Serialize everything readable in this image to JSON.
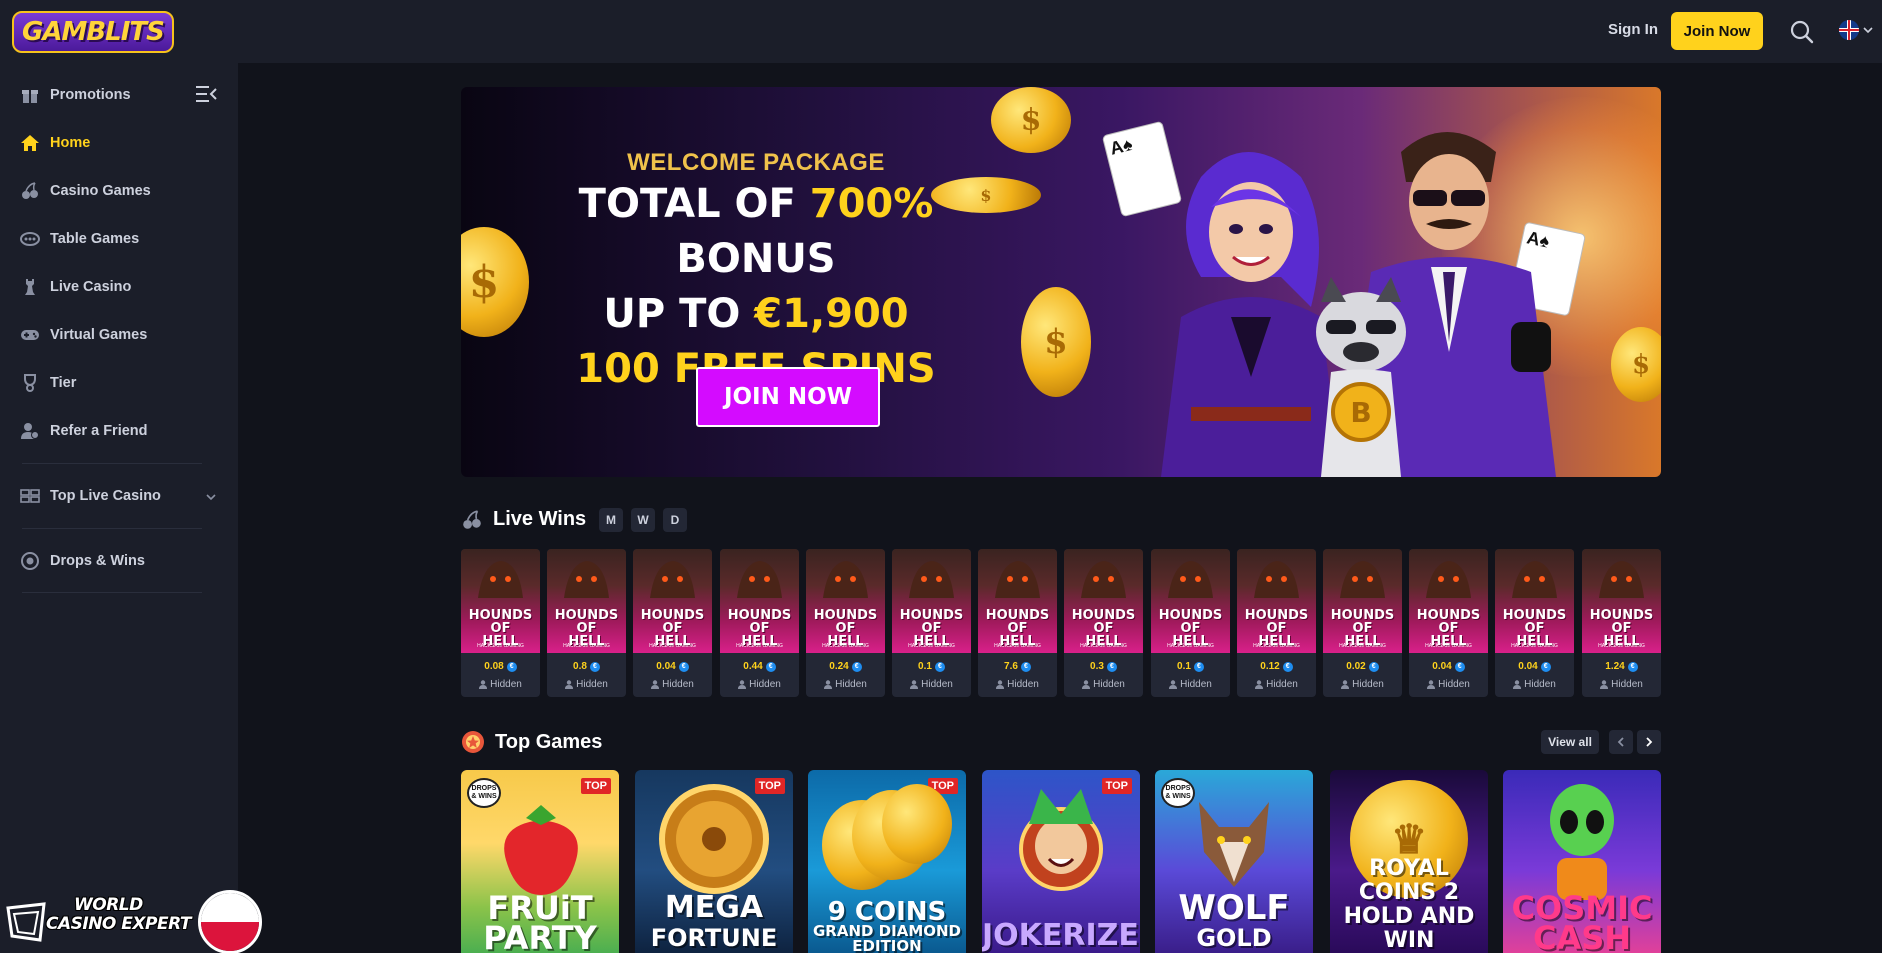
{
  "header": {
    "logo_text": "GAMBLITS",
    "signin_label": "Sign In",
    "join_label": "Join Now",
    "search_icon": "search-icon",
    "language_flag": "uk-flag-icon"
  },
  "sidebar": {
    "items": [
      {
        "label": "Promotions",
        "icon": "gift-icon"
      },
      {
        "label": "Home",
        "icon": "home-icon",
        "active": true
      },
      {
        "label": "Casino Games",
        "icon": "cherries-icon"
      },
      {
        "label": "Table Games",
        "icon": "table-icon"
      },
      {
        "label": "Live Casino",
        "icon": "chess-icon"
      },
      {
        "label": "Virtual Games",
        "icon": "gamepad-icon"
      },
      {
        "label": "Tier",
        "icon": "trophy-icon"
      },
      {
        "label": "Refer a Friend",
        "icon": "users-icon"
      },
      {
        "label": "Top Live Casino",
        "icon": "grid-icon"
      },
      {
        "label": "Drops & Wins",
        "icon": "drops-wins-icon"
      }
    ],
    "accent_color": "#ffd21c"
  },
  "banner": {
    "subtitle": "WELCOME PACKAGE",
    "line1_a": "TOTAL OF ",
    "line1_b": "700%",
    "line1_c": " BONUS",
    "line2_a": "UP TO ",
    "line2_b": "€1,900",
    "line3": "100 FREE SPINS",
    "cta": "JOIN NOW"
  },
  "live_wins": {
    "title": "Live Wins",
    "filters": [
      "M",
      "W",
      "D"
    ],
    "game_title_1": "HOUNDS OF",
    "game_title_2": "HELL",
    "game_studio": "HACKSAW GAMING",
    "items": [
      {
        "amount": "0.08",
        "user": "Hidden"
      },
      {
        "amount": "0.8",
        "user": "Hidden"
      },
      {
        "amount": "0.04",
        "user": "Hidden"
      },
      {
        "amount": "0.44",
        "user": "Hidden"
      },
      {
        "amount": "0.24",
        "user": "Hidden"
      },
      {
        "amount": "0.1",
        "user": "Hidden"
      },
      {
        "amount": "7.6",
        "user": "Hidden"
      },
      {
        "amount": "0.3",
        "user": "Hidden"
      },
      {
        "amount": "0.1",
        "user": "Hidden"
      },
      {
        "amount": "0.12",
        "user": "Hidden"
      },
      {
        "amount": "0.02",
        "user": "Hidden"
      },
      {
        "amount": "0.04",
        "user": "Hidden"
      },
      {
        "amount": "0.04",
        "user": "Hidden"
      },
      {
        "amount": "1.24",
        "user": "Hidden"
      }
    ]
  },
  "top_games": {
    "title": "Top Games",
    "view_all": "View all",
    "top_badge": "TOP",
    "drops_badge": "DROPS & WINS",
    "games": [
      {
        "line1": "FRUiT",
        "line2": "PARTY"
      },
      {
        "line1": "MEGA",
        "line2": "FORTUNE"
      },
      {
        "line1": "9 COINS",
        "line2": "GRAND DIAMOND",
        "line3": "EDITION"
      },
      {
        "line1": "JOKERIZER"
      },
      {
        "line1": "WOLF",
        "line2": "GOLD"
      },
      {
        "line1": "ROYAL COINS 2",
        "line2": "HOLD AND WIN"
      },
      {
        "line1": "COSMIC",
        "line2": "CASH"
      }
    ]
  },
  "watermark": {
    "line1": "WORLD",
    "line2": "CASINO EXPERT"
  }
}
